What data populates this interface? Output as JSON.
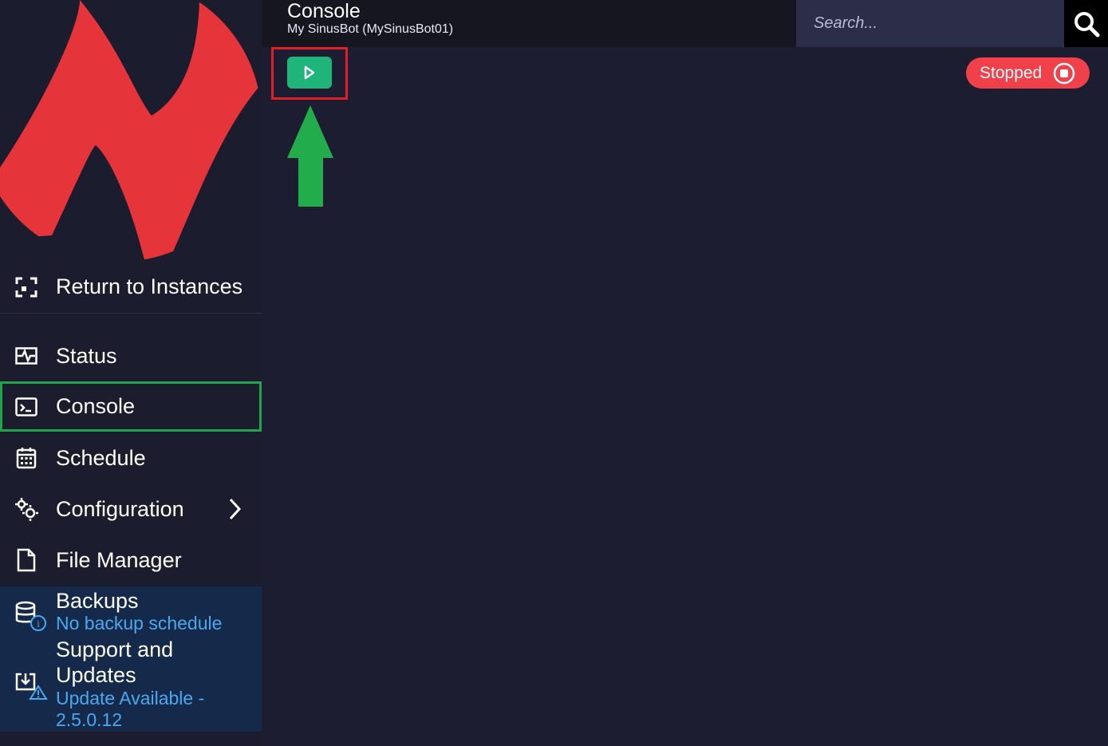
{
  "header": {
    "title": "Console",
    "subtitle": "My SinusBot (MySinusBot01)",
    "search_placeholder": "Search..."
  },
  "sidebar": {
    "return_label": "Return to Instances",
    "items": [
      {
        "label": "Status",
        "icon": "status-pulse-icon"
      },
      {
        "label": "Console",
        "icon": "terminal-icon",
        "active": true
      },
      {
        "label": "Schedule",
        "icon": "calendar-icon"
      },
      {
        "label": "Configuration",
        "icon": "gears-icon",
        "expandable": true
      },
      {
        "label": "File Manager",
        "icon": "file-icon"
      }
    ],
    "backups": {
      "title": "Backups",
      "status": "No backup schedule"
    },
    "support": {
      "title_line1": "Support and",
      "title_line2": "Updates",
      "status_line1": "Update Available -",
      "status_line2": "2.5.0.12"
    }
  },
  "main": {
    "state_label": "Stopped"
  },
  "colors": {
    "accent_green": "#1fb47a",
    "stopped_red": "#f0414a",
    "highlight_red": "#e01e28",
    "highlight_green": "#1fa64a",
    "link_blue": "#4aa8f0"
  }
}
